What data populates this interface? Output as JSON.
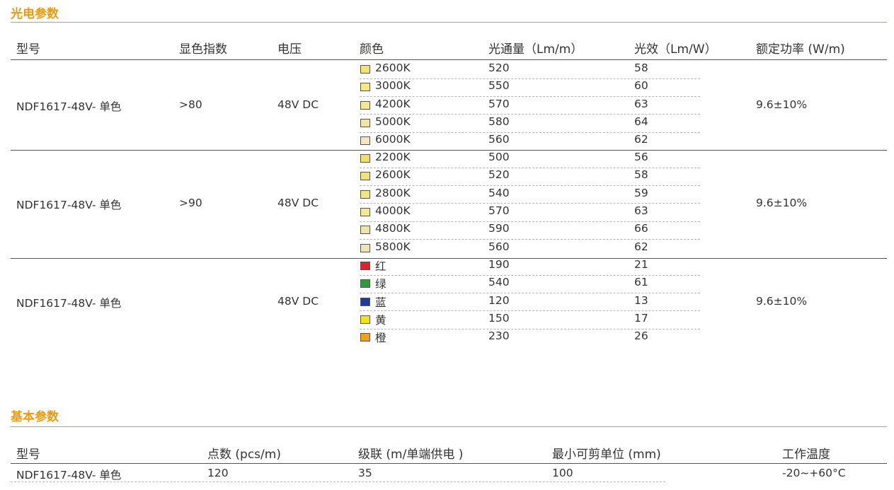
{
  "section1": {
    "title": "光电参数",
    "headers": {
      "model": "型号",
      "cri": "显色指数",
      "voltage": "电压",
      "color": "颜色",
      "flux": "光通量（Lm/m）",
      "efficacy": "光效（Lm/W）",
      "power": "额定功率 (W/m)"
    },
    "groups": [
      {
        "model": "NDF1617-48V- 单色",
        "cri": ">80",
        "voltage": "48V DC",
        "power": "9.6±10%",
        "rows": [
          {
            "color": "2600K",
            "swatch": "#f3e27a",
            "flux": "520",
            "efficacy": "58"
          },
          {
            "color": "3000K",
            "swatch": "#f5e882",
            "flux": "550",
            "efficacy": "60"
          },
          {
            "color": "4200K",
            "swatch": "#f5e894",
            "flux": "570",
            "efficacy": "63"
          },
          {
            "color": "5000K",
            "swatch": "#f1e4a8",
            "flux": "580",
            "efficacy": "64"
          },
          {
            "color": "6000K",
            "swatch": "#efe6c2",
            "flux": "560",
            "efficacy": "62"
          }
        ]
      },
      {
        "model": "NDF1617-48V- 单色",
        "cri": ">90",
        "voltage": "48V DC",
        "power": "9.6±10%",
        "rows": [
          {
            "color": "2200K",
            "swatch": "#f2de6e",
            "flux": "500",
            "efficacy": "56"
          },
          {
            "color": "2600K",
            "swatch": "#f3e27a",
            "flux": "520",
            "efficacy": "58"
          },
          {
            "color": "2800K",
            "swatch": "#f3e585",
            "flux": "540",
            "efficacy": "59"
          },
          {
            "color": "4000K",
            "swatch": "#f5e894",
            "flux": "570",
            "efficacy": "63"
          },
          {
            "color": "4800K",
            "swatch": "#f1e4a8",
            "flux": "590",
            "efficacy": "66"
          },
          {
            "color": "5800K",
            "swatch": "#efe4b8",
            "flux": "560",
            "efficacy": "62"
          }
        ]
      },
      {
        "model": "NDF1617-48V- 单色",
        "cri": "",
        "voltage": "48V DC",
        "power": "9.6±10%",
        "rows": [
          {
            "color": "红",
            "swatch": "#d3262e",
            "flux": "190",
            "efficacy": "21"
          },
          {
            "color": "绿",
            "swatch": "#2f9a3a",
            "flux": "540",
            "efficacy": "61"
          },
          {
            "color": "蓝",
            "swatch": "#1d3c97",
            "flux": "120",
            "efficacy": "13"
          },
          {
            "color": "黄",
            "swatch": "#f2e21a",
            "flux": "150",
            "efficacy": "17"
          },
          {
            "color": "橙",
            "swatch": "#f0a11c",
            "flux": "230",
            "efficacy": "26"
          }
        ]
      }
    ]
  },
  "section2": {
    "title": "基本参数",
    "headers": {
      "model": "型号",
      "points": "点数 (pcs/m)",
      "cascade": "级联 (m/单端供电 )",
      "min_cut": "最小可剪单位 (mm)",
      "temp": "工作温度"
    },
    "row": {
      "model": "NDF1617-48V- 单色",
      "points": "120",
      "cascade": "35",
      "min_cut": "100",
      "temp": "-20~+60°C"
    }
  }
}
